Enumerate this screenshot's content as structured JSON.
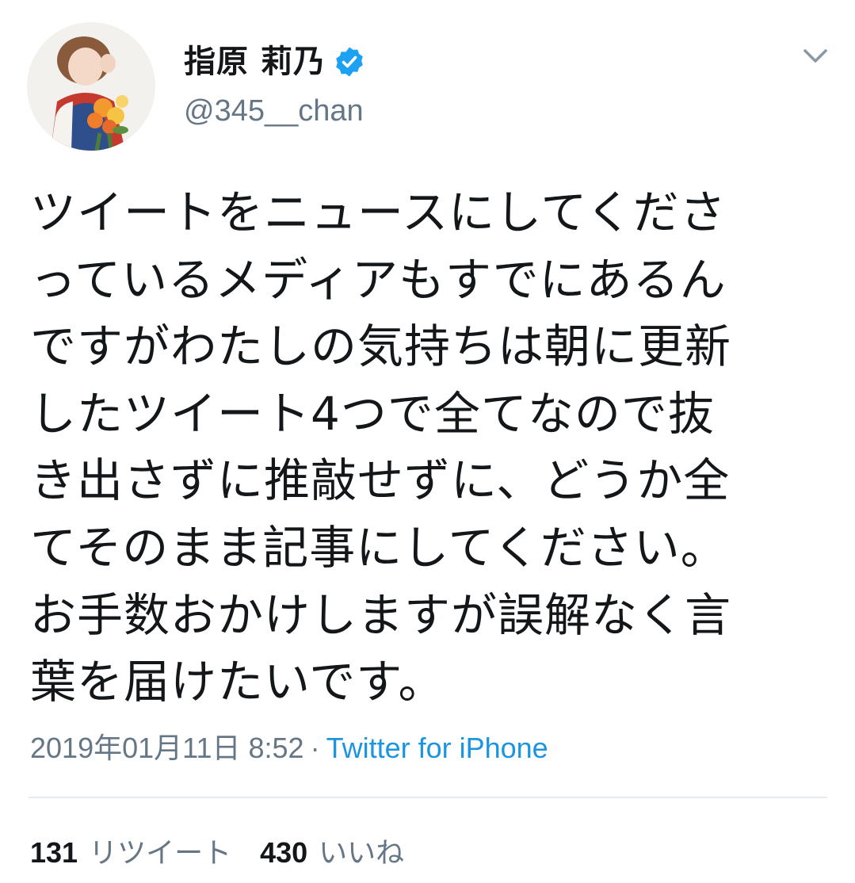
{
  "user": {
    "display_name": "指原 莉乃",
    "handle": "@345__chan",
    "verified_icon": "verified-badge-icon",
    "avatar_icon": "profile-photo"
  },
  "tweet": {
    "lines": [
      "ツイートをニュースにしてくださ",
      "っているメディアもすでにあるん",
      "ですがわたしの気持ちは朝に更新",
      "したツイート4つで全てなので抜",
      "き出さずに推敲せずに、どうか全",
      "てそのまま記事にしてください。",
      "お手数おかけしますが誤解なく言",
      "葉を届けたいです。"
    ]
  },
  "meta": {
    "timestamp": "2019年01月11日 8:52",
    "separator": "·",
    "source": "Twitter for iPhone"
  },
  "stats": {
    "retweet_count": "131",
    "retweet_label": "リツイート",
    "like_count": "430",
    "like_label": "いいね"
  },
  "colors": {
    "text": "#14171a",
    "secondary": "#657786",
    "link": "#1b95e0",
    "verified": "#1da1f2",
    "divider": "#e6ecf0"
  }
}
